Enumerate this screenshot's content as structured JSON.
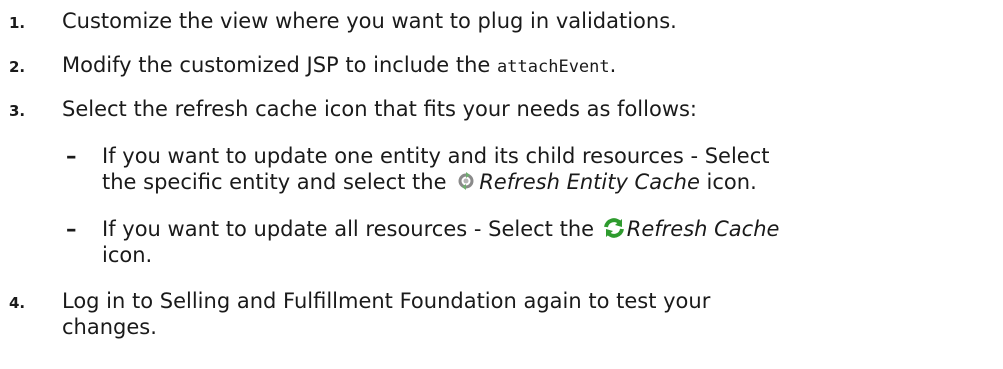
{
  "steps": [
    {
      "number": "1.",
      "text": "Customize the view where you want to plug in validations."
    },
    {
      "number": "2.",
      "text_before": "Modify the customized JSP to include the ",
      "code": "attachEvent",
      "text_after": "."
    },
    {
      "number": "3.",
      "text": "Select the refresh cache icon that fits your needs as follows:"
    },
    {
      "number": "4.",
      "text_line1": "Log in to Selling and Fulfillment Foundation again to test your",
      "text_line2": "changes."
    }
  ],
  "subitems": [
    {
      "dash": "–",
      "line1": "If you want to update one entity and its child resources - Select",
      "line2_before": "the specific entity and select the ",
      "icon": "refresh-entity-cache-icon",
      "label": "Refresh Entity Cache",
      "line2_after": " icon."
    },
    {
      "dash": "–",
      "line1_before": "If you want to update all resources - Select the ",
      "icon": "refresh-cache-icon",
      "label": "Refresh Cache",
      "line2": "icon."
    }
  ],
  "colors": {
    "text": "#1a1a1a",
    "icon_green": "#2e9b2e",
    "icon_gray": "#8a8a8a"
  }
}
